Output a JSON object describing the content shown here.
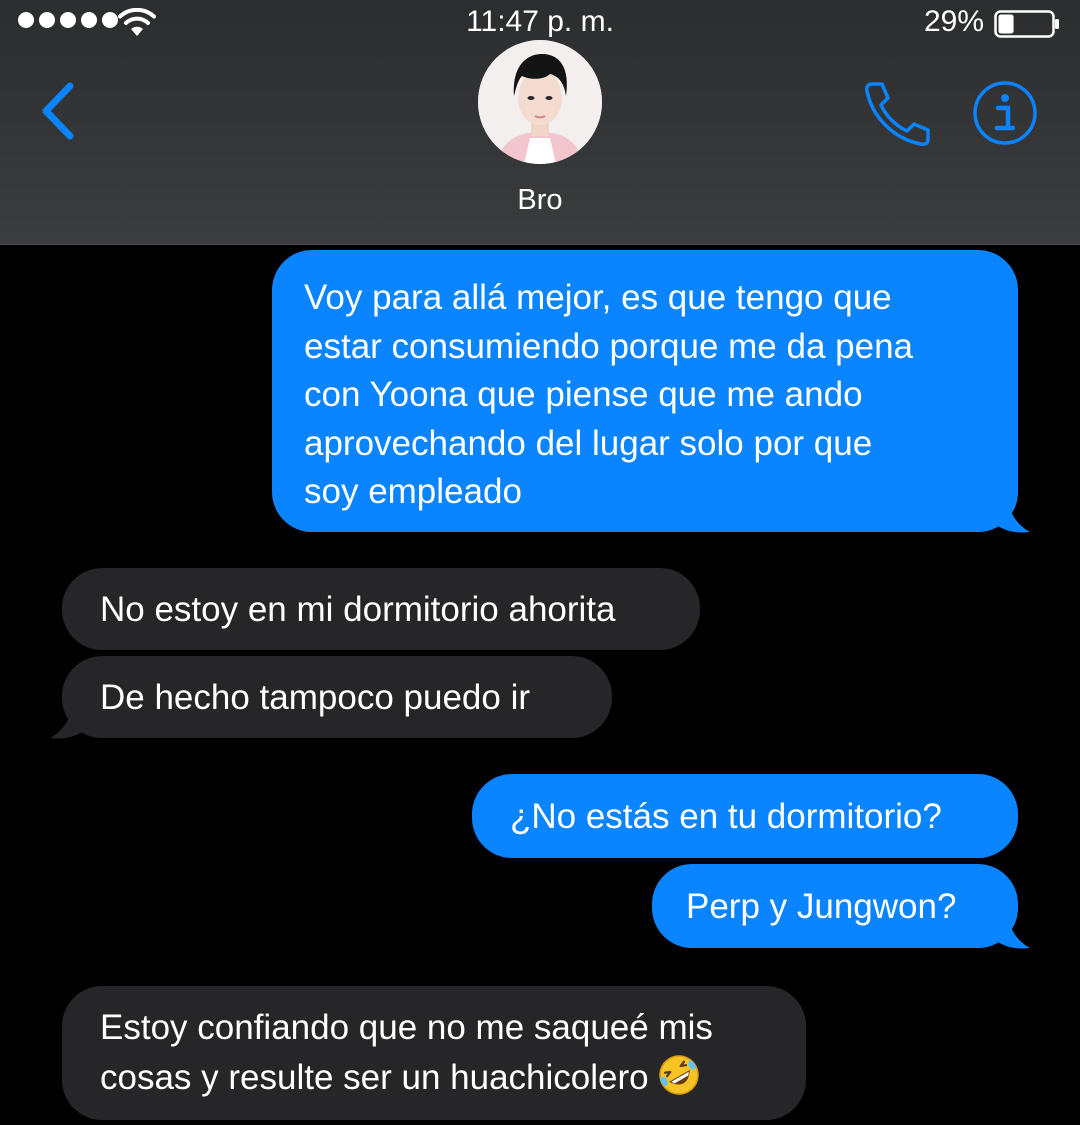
{
  "status_bar": {
    "time": "11:47 p. m.",
    "battery_percent": "29%",
    "battery_level": 0.29,
    "signal_bars": 5,
    "wifi_icon": "wifi-icon"
  },
  "header": {
    "contact_name": "Bro",
    "back_icon": "chevron-left-icon",
    "call_icon": "phone-icon",
    "info_icon": "info-icon",
    "avatar": "contact-avatar"
  },
  "colors": {
    "accent": "#0a84ff",
    "outgoing_bubble": "#0a84ff",
    "incoming_bubble": "#262629",
    "header_background": "#3a3a3c",
    "background": "#000000"
  },
  "messages": [
    {
      "direction": "outgoing",
      "lines": [
        "Voy para allá mejor, es que tengo que",
        "estar consumiendo porque me da pena",
        "con Yoona que piense que me ando",
        "aprovechando del lugar solo por que",
        "soy empleado"
      ]
    },
    {
      "direction": "incoming",
      "lines": [
        "No estoy en mi dormitorio ahorita"
      ]
    },
    {
      "direction": "incoming",
      "lines": [
        "De hecho tampoco puedo ir"
      ]
    },
    {
      "direction": "outgoing",
      "lines": [
        "¿No estás en tu dormitorio?"
      ]
    },
    {
      "direction": "outgoing",
      "lines": [
        "Perp y Jungwon?"
      ]
    },
    {
      "direction": "incoming",
      "lines": [
        "Estoy confiando que no me saqueé mis",
        "cosas y resulte ser un huachicolero"
      ],
      "emoji": "rolling-on-floor-laughing-emoji"
    }
  ]
}
